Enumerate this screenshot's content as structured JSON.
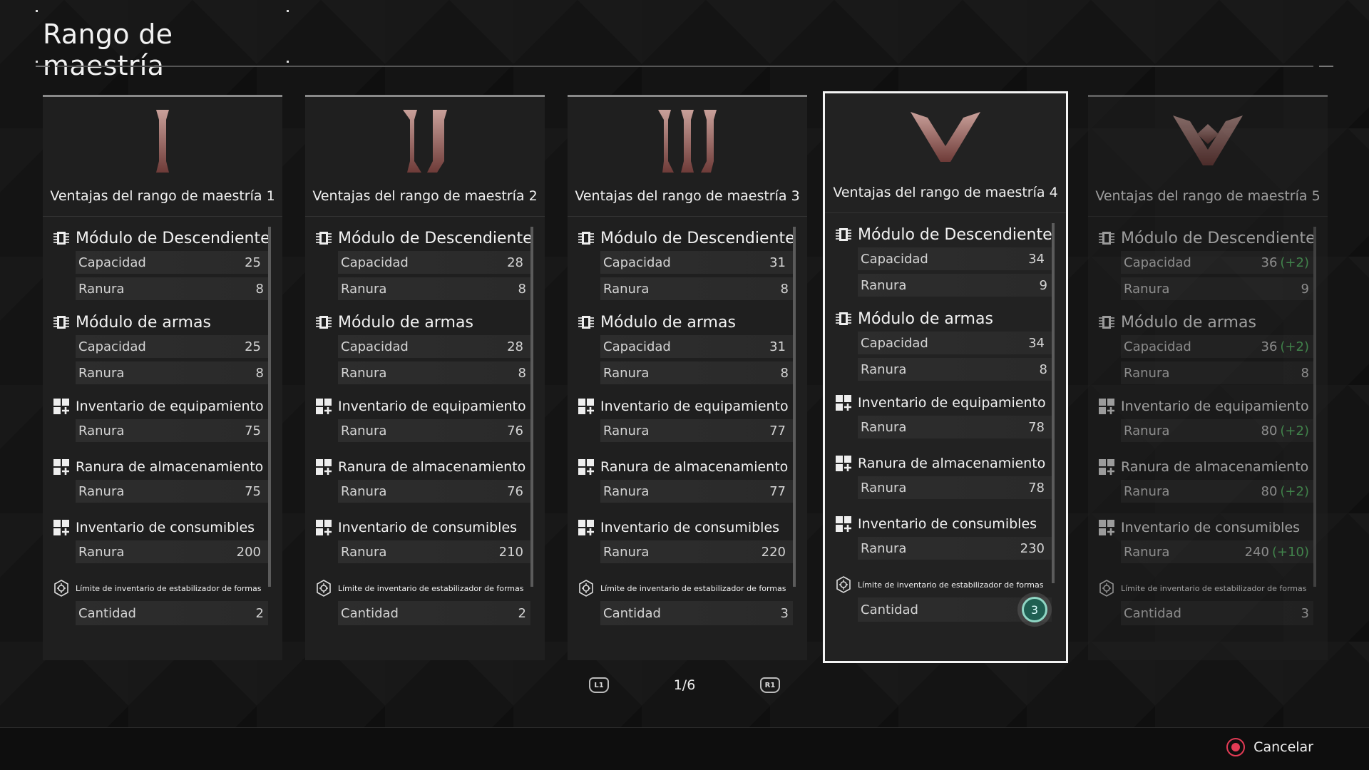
{
  "title": "Rango de maestría",
  "cards": [
    {
      "title": "Ventajas del rango de maestría 1",
      "rank_icon": "rank-1-icon",
      "descendiente": {
        "label": "Módulo de Descendiente",
        "capacidad_label": "Capacidad",
        "capacidad": "25",
        "capacidad_bonus": "",
        "ranura_label": "Ranura",
        "ranura": "8"
      },
      "armas": {
        "label": "Módulo de armas",
        "capacidad_label": "Capacidad",
        "capacidad": "25",
        "capacidad_bonus": "",
        "ranura_label": "Ranura",
        "ranura": "8"
      },
      "equipamiento": {
        "label": "Inventario de equipamiento",
        "ranura_label": "Ranura",
        "ranura": "75",
        "ranura_bonus": ""
      },
      "almacenamiento": {
        "label": "Ranura de almacenamiento",
        "ranura_label": "Ranura",
        "ranura": "75",
        "ranura_bonus": ""
      },
      "consumibles": {
        "label": "Inventario de consumibles",
        "ranura_label": "Ranura",
        "ranura": "200",
        "ranura_bonus": ""
      },
      "estabilizador": {
        "label": "Límite de inventario de estabilizador de formas",
        "cantidad_label": "Cantidad",
        "cantidad": "2"
      }
    },
    {
      "title": "Ventajas del rango de maestría 2",
      "rank_icon": "rank-2-icon",
      "descendiente": {
        "label": "Módulo de Descendiente",
        "capacidad_label": "Capacidad",
        "capacidad": "28",
        "capacidad_bonus": "",
        "ranura_label": "Ranura",
        "ranura": "8"
      },
      "armas": {
        "label": "Módulo de armas",
        "capacidad_label": "Capacidad",
        "capacidad": "28",
        "capacidad_bonus": "",
        "ranura_label": "Ranura",
        "ranura": "8"
      },
      "equipamiento": {
        "label": "Inventario de equipamiento",
        "ranura_label": "Ranura",
        "ranura": "76",
        "ranura_bonus": ""
      },
      "almacenamiento": {
        "label": "Ranura de almacenamiento",
        "ranura_label": "Ranura",
        "ranura": "76",
        "ranura_bonus": ""
      },
      "consumibles": {
        "label": "Inventario de consumibles",
        "ranura_label": "Ranura",
        "ranura": "210",
        "ranura_bonus": ""
      },
      "estabilizador": {
        "label": "Límite de inventario de estabilizador de formas",
        "cantidad_label": "Cantidad",
        "cantidad": "2"
      }
    },
    {
      "title": "Ventajas del rango de maestría 3",
      "rank_icon": "rank-3-icon",
      "descendiente": {
        "label": "Módulo de Descendiente",
        "capacidad_label": "Capacidad",
        "capacidad": "31",
        "capacidad_bonus": "",
        "ranura_label": "Ranura",
        "ranura": "8"
      },
      "armas": {
        "label": "Módulo de armas",
        "capacidad_label": "Capacidad",
        "capacidad": "31",
        "capacidad_bonus": "",
        "ranura_label": "Ranura",
        "ranura": "8"
      },
      "equipamiento": {
        "label": "Inventario de equipamiento",
        "ranura_label": "Ranura",
        "ranura": "77",
        "ranura_bonus": ""
      },
      "almacenamiento": {
        "label": "Ranura de almacenamiento",
        "ranura_label": "Ranura",
        "ranura": "77",
        "ranura_bonus": ""
      },
      "consumibles": {
        "label": "Inventario de consumibles",
        "ranura_label": "Ranura",
        "ranura": "220",
        "ranura_bonus": ""
      },
      "estabilizador": {
        "label": "Límite de inventario de estabilizador de formas",
        "cantidad_label": "Cantidad",
        "cantidad": "3"
      }
    },
    {
      "title": "Ventajas del rango de maestría 4",
      "rank_icon": "rank-4-icon",
      "descendiente": {
        "label": "Módulo de Descendiente",
        "capacidad_label": "Capacidad",
        "capacidad": "34",
        "capacidad_bonus": "",
        "ranura_label": "Ranura",
        "ranura": "9"
      },
      "armas": {
        "label": "Módulo de armas",
        "capacidad_label": "Capacidad",
        "capacidad": "34",
        "capacidad_bonus": "",
        "ranura_label": "Ranura",
        "ranura": "8"
      },
      "equipamiento": {
        "label": "Inventario de equipamiento",
        "ranura_label": "Ranura",
        "ranura": "78",
        "ranura_bonus": ""
      },
      "almacenamiento": {
        "label": "Ranura de almacenamiento",
        "ranura_label": "Ranura",
        "ranura": "78",
        "ranura_bonus": ""
      },
      "consumibles": {
        "label": "Inventario de consumibles",
        "ranura_label": "Ranura",
        "ranura": "230",
        "ranura_bonus": ""
      },
      "estabilizador": {
        "label": "Límite de inventario de estabilizador de formas",
        "cantidad_label": "Cantidad",
        "cantidad": "3"
      }
    },
    {
      "title": "Ventajas del rango de maestría 5",
      "rank_icon": "rank-5-icon",
      "descendiente": {
        "label": "Módulo de Descendiente",
        "capacidad_label": "Capacidad",
        "capacidad": "36",
        "capacidad_bonus": "(+2)",
        "ranura_label": "Ranura",
        "ranura": "9"
      },
      "armas": {
        "label": "Módulo de armas",
        "capacidad_label": "Capacidad",
        "capacidad": "36",
        "capacidad_bonus": "(+2)",
        "ranura_label": "Ranura",
        "ranura": "8"
      },
      "equipamiento": {
        "label": "Inventario de equipamiento",
        "ranura_label": "Ranura",
        "ranura": "80",
        "ranura_bonus": "(+2)"
      },
      "almacenamiento": {
        "label": "Ranura de almacenamiento",
        "ranura_label": "Ranura",
        "ranura": "80",
        "ranura_bonus": "(+2)"
      },
      "consumibles": {
        "label": "Inventario de consumibles",
        "ranura_label": "Ranura",
        "ranura": "240",
        "ranura_bonus": "(+10)"
      },
      "estabilizador": {
        "label": "Límite de inventario de estabilizador de formas",
        "cantidad_label": "Cantidad",
        "cantidad": "3"
      }
    }
  ],
  "selected_card": 3,
  "pager": {
    "prev": "L1",
    "page": "1/6",
    "next": "R1"
  },
  "footer": {
    "cancel": "Cancelar"
  },
  "colors": {
    "bonus": "#5bc46b",
    "accent_badge": "#1f5f52",
    "cancel": "#e23b55"
  }
}
